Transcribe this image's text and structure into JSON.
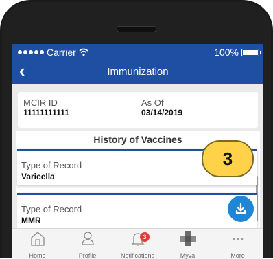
{
  "status_bar": {
    "carrier": "Carrier",
    "battery": "100%"
  },
  "header": {
    "title": "Immunization"
  },
  "identity": {
    "mcir_label": "MCIR ID",
    "mcir_value": "11111111111",
    "as_of_label": "As Of",
    "as_of_value": "03/14/2019"
  },
  "history": {
    "title": "History of Vaccines",
    "records": [
      {
        "label": "Type of Record",
        "value": "Varicella"
      },
      {
        "label": "Type of Record",
        "value": "MMR"
      }
    ]
  },
  "callout": {
    "number": "3"
  },
  "tabbar": {
    "items": [
      {
        "label": "Home",
        "icon": "home-icon"
      },
      {
        "label": "Profile",
        "icon": "profile-icon"
      },
      {
        "label": "Notifications",
        "icon": "bell-icon",
        "badge": "3"
      },
      {
        "label": "Myva",
        "icon": "myva-icon"
      },
      {
        "label": "More",
        "icon": "more-dots-icon"
      }
    ]
  },
  "colors": {
    "brand": "#1e4fa3",
    "fab": "#1f86d6",
    "callout": "#ffd24a",
    "badge": "#e53935"
  }
}
